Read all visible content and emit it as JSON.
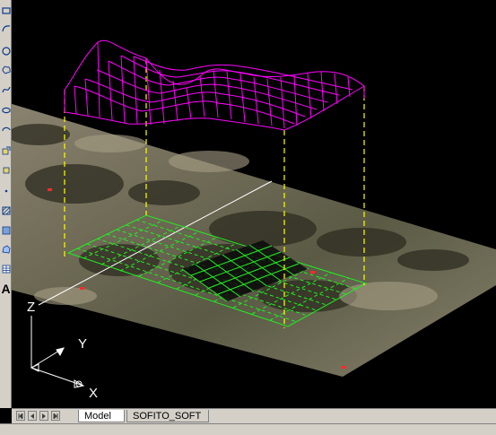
{
  "tabs": {
    "model_label": "Model",
    "layout_label": "SOFITO_SOFT"
  },
  "ucs": {
    "x_label": "X",
    "y_label": "Y",
    "z_label": "Z"
  },
  "toolbar": {
    "text_tool_glyph": "A",
    "icons": [
      "rectangle-icon",
      "arc-icon",
      "circle-icon",
      "revision-cloud-icon",
      "spline-icon",
      "ellipse-icon",
      "ellipse-arc-icon",
      "insert-block-icon",
      "make-block-icon",
      "point-icon",
      "hatch-icon",
      "gradient-icon",
      "region-icon",
      "table-icon",
      "multiline-text-icon"
    ]
  },
  "colors": {
    "surface_mesh": "#ff00ff",
    "terrain_grid": "#22ee22",
    "projection_lines": "#ffff00",
    "ucs_icon": "#ffffff",
    "background": "#000000"
  }
}
